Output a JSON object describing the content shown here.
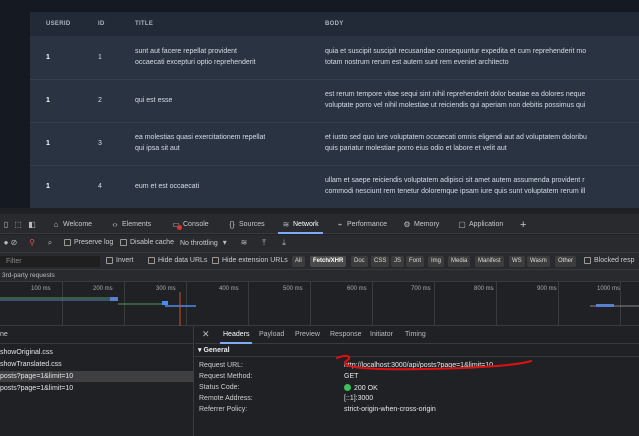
{
  "table": {
    "headers": [
      "USERID",
      "ID",
      "TITLE",
      "BODY"
    ],
    "rows": [
      {
        "userid": "1",
        "id": "1",
        "title": [
          "sunt aut facere repellat provident",
          "occaecati excepturi optio reprehenderit"
        ],
        "body": [
          "quia et suscipit suscipit recusandae consequuntur expedita et cum reprehenderit mo",
          "totam nostrum rerum est autem sunt rem eveniet architecto"
        ]
      },
      {
        "userid": "1",
        "id": "2",
        "title": [
          "qui est esse",
          ""
        ],
        "body": [
          "est rerum tempore vitae sequi sint nihil reprehenderit dolor beatae ea dolores neque",
          "voluptate porro vel nihil molestiae ut reiciendis qui aperiam non debitis possimus qui"
        ]
      },
      {
        "userid": "1",
        "id": "3",
        "title": [
          "ea molestias quasi exercitationem repellat",
          "qui ipsa sit aut"
        ],
        "body": [
          "et iusto sed quo iure voluptatem occaecati omnis eligendi aut ad voluptatem doloribu",
          "quis pariatur molestiae porro eius odio et labore et velit aut"
        ]
      },
      {
        "userid": "1",
        "id": "4",
        "title": [
          "eum et est occaecati",
          ""
        ],
        "body": [
          "ullam et saepe reiciendis voluptatem adipisci sit amet autem assumenda provident r",
          "commodi nesciunt rem tenetur doloremque ipsam iure quis sunt voluptatem rerum ill"
        ]
      }
    ]
  },
  "devtools": {
    "tabs": [
      {
        "label": "Welcome",
        "icon": "home-icon"
      },
      {
        "label": "Elements",
        "icon": "code-icon"
      },
      {
        "label": "Console",
        "icon": "console-icon"
      },
      {
        "label": "Sources",
        "icon": "sources-icon"
      },
      {
        "label": "Network",
        "icon": "wifi-icon"
      },
      {
        "label": "Performance",
        "icon": "performance-icon"
      },
      {
        "label": "Memory",
        "icon": "memory-icon"
      },
      {
        "label": "Application",
        "icon": "application-icon"
      }
    ],
    "active_tab": "Network",
    "toolbar": {
      "preserve_log": "Preserve log",
      "disable_cache": "Disable cache",
      "throttling": "No throttling"
    },
    "filter": {
      "placeholder": "Filter",
      "invert": "Invert",
      "hide_data_urls": "Hide data URLs",
      "hide_extension_urls": "Hide extension URLs",
      "types": [
        "All",
        "Fetch/XHR",
        "Doc",
        "CSS",
        "JS",
        "Font",
        "Img",
        "Media",
        "Manifest",
        "WS",
        "Wasm",
        "Other"
      ],
      "selected_type": "Fetch/XHR",
      "blocked": "Blocked resp"
    },
    "third_party": "3rd-party requests",
    "timeline_ticks": [
      "100 ms",
      "200 ms",
      "300 ms",
      "400 ms",
      "500 ms",
      "600 ms",
      "700 ms",
      "800 ms",
      "900 ms",
      "1000 ms"
    ],
    "requests": {
      "header": "ne",
      "items": [
        "showOriginal.css",
        "showTranslated.css",
        "posts?page=1&limit=10",
        "posts?page=1&limit=10"
      ],
      "selected_index": 2
    },
    "details": {
      "tabs": [
        "Headers",
        "Payload",
        "Preview",
        "Response",
        "Initiator",
        "Timing"
      ],
      "active": "Headers",
      "section": "General",
      "fields": [
        {
          "key": "Request URL:",
          "value": "http://localhost:3000/api/posts?page=1&limit=10"
        },
        {
          "key": "Request Method:",
          "value": "GET"
        },
        {
          "key": "Status Code:",
          "value": "200 OK"
        },
        {
          "key": "Remote Address:",
          "value": "[::1]:3000"
        },
        {
          "key": "Referrer Policy:",
          "value": "strict-origin-when-cross-origin"
        }
      ],
      "status_color": "#3cbf5c",
      "annotation_color": "#e01010"
    }
  }
}
